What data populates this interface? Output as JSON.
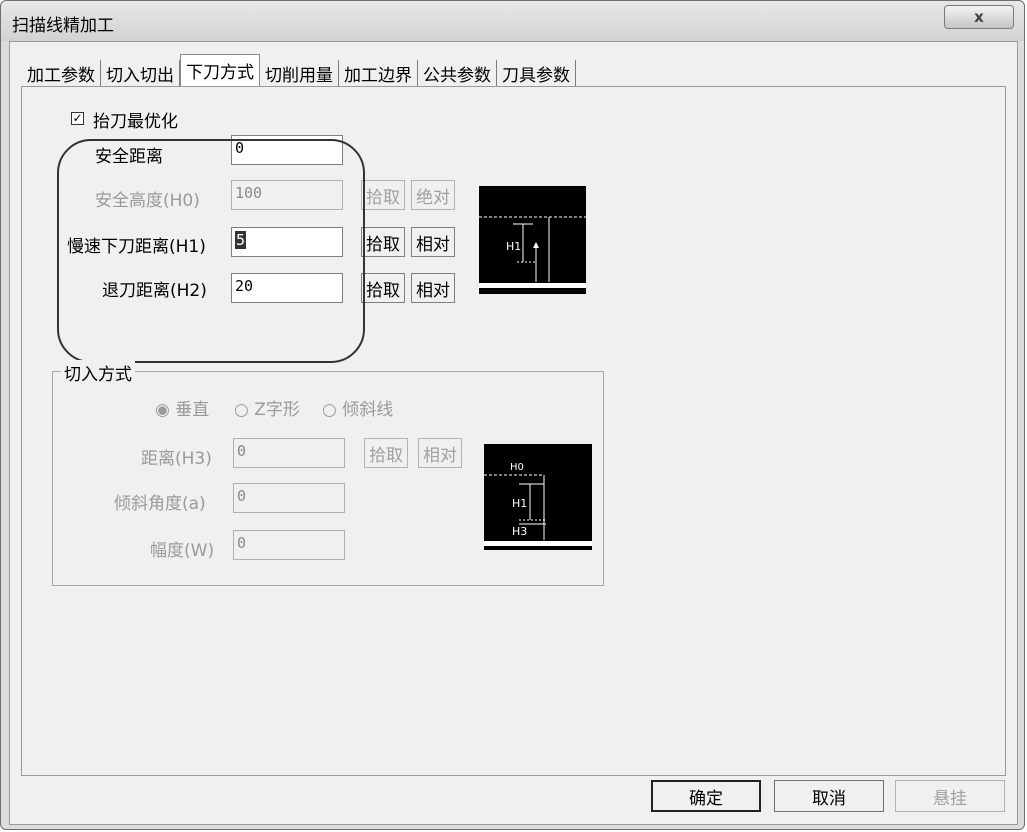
{
  "window": {
    "title": "扫描线精加工",
    "close_label": "x"
  },
  "tabs": [
    "加工参数",
    "切入切出",
    "下刀方式",
    "切削用量",
    "加工边界",
    "公共参数",
    "刀具参数"
  ],
  "active_tab": "下刀方式",
  "lift": {
    "optimize_label": "抬刀最优化",
    "optimize_checked": true,
    "check_glyph": "✓",
    "safe_distance_label": "安全距离",
    "safe_distance_value": "0",
    "safe_height_label": "安全高度(H0)",
    "safe_height_value": "100",
    "slow_feed_label": "慢速下刀距离(H1)",
    "slow_feed_value": "5",
    "retract_label": "退刀距离(H2)",
    "retract_value": "20",
    "pick_label": "拾取",
    "absolute_label": "绝对",
    "relative_label": "相对",
    "diagram_h1": "H1"
  },
  "entry": {
    "group_title": "切入方式",
    "radio_vertical": "垂直",
    "radio_zigzag": "Z字形",
    "radio_ramp": "倾斜线",
    "selected": "垂直",
    "distance_label": "距离(H3)",
    "distance_value": "0",
    "angle_label": "倾斜角度(a)",
    "angle_value": "0",
    "width_label": "幅度(W)",
    "width_value": "0",
    "pick_label": "拾取",
    "relative_label": "相对",
    "diagram_h0": "H0",
    "diagram_h1": "H1",
    "diagram_h3": "H3"
  },
  "buttons": {
    "ok": "确定",
    "cancel": "取消",
    "suspend": "悬挂"
  }
}
